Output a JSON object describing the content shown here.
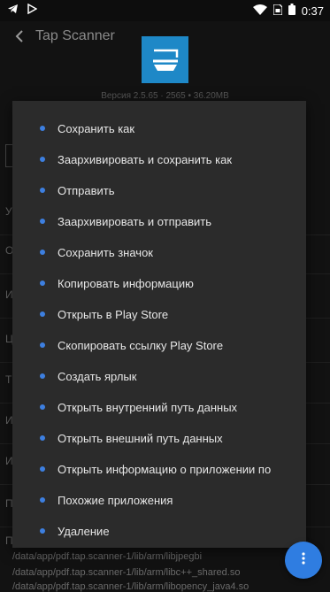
{
  "status_bar": {
    "time": "0:37",
    "icons": [
      "telegram-icon",
      "play-store-icon",
      "wifi-icon",
      "sim-icon",
      "battery-icon"
    ]
  },
  "app_bar": {
    "title": "Tap Scanner",
    "back_icon": "back-arrow-icon"
  },
  "app_info": {
    "version": "Версия 2.5.65 · 2565 • 36.20MB"
  },
  "background_rows": [
    "У",
    "О",
    "И",
    "Ц",
    "Т",
    "И",
    "И",
    "П",
    "П"
  ],
  "background_paths": [
    "/data/app/pdf.tap.scanner-1/lib/arm/libjpegbi",
    "/data/app/pdf.tap.scanner-1/lib/arm/libc++_shared.so",
    "/data/app/pdf.tap.scanner-1/lib/arm/libopency_java4.so"
  ],
  "menu": {
    "items": [
      {
        "label": "Сохранить как"
      },
      {
        "label": "Заархивировать и сохранить как"
      },
      {
        "label": "Отправить"
      },
      {
        "label": "Заархивировать и отправить"
      },
      {
        "label": "Сохранить значок"
      },
      {
        "label": "Копировать информацию"
      },
      {
        "label": "Открыть в Play Store"
      },
      {
        "label": "Скопировать ссылку Play Store"
      },
      {
        "label": "Создать ярлык"
      },
      {
        "label": "Открыть внутренний путь данных"
      },
      {
        "label": "Открыть внешний путь данных"
      },
      {
        "label": "Открыть информацию о приложении по"
      },
      {
        "label": "Похожие приложения"
      },
      {
        "label": "Удаление"
      }
    ]
  },
  "fab": {
    "icon": "more-vert-icon"
  },
  "colors": {
    "accent": "#3d7fe0",
    "menu_bg": "#2b2b2b",
    "app_icon_bg": "#1e88c7"
  }
}
